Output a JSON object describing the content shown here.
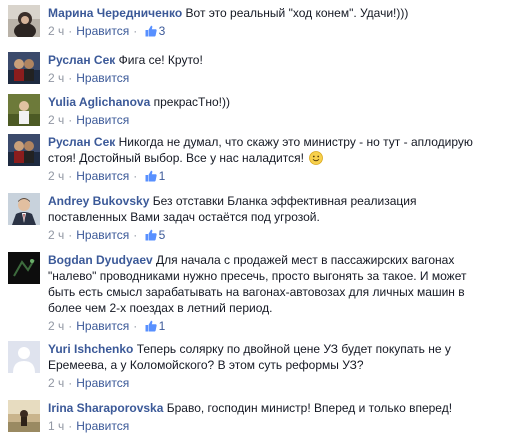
{
  "like_label": "Нравится",
  "comments": [
    {
      "author": "Марина Чередниченко",
      "text": "Вот это реальный \"ход конем\". Удачи!)))",
      "time": "2 ч",
      "likes": "3"
    },
    {
      "author": "Руслан Сек",
      "text": "Фига се! Круто!",
      "time": "2 ч",
      "likes": ""
    },
    {
      "author": "Yulia Aglichanova",
      "text": "прекрасТно!))",
      "time": "2 ч",
      "likes": ""
    },
    {
      "author": "Руслан Сек",
      "text": "Никогда не думал, что скажу это министру - но тут - аплодирую стоя! Достойный выбор. Все у нас наладится!",
      "time": "2 ч",
      "likes": "1"
    },
    {
      "author": "Andrey Bukovsky",
      "text": "Без отставки Бланка эффективная реализация поставленных Вами задач остаётся под угрозой.",
      "time": "2 ч",
      "likes": "5"
    },
    {
      "author": "Bogdan Dyudyaev",
      "text": "Для начала с продажей мест в пассажирских вагонах \"налево\" проводниками нужно пресечь, просто выгонять за такое. И может быть есть смысл зарабатывать на вагонах-автовозах для личных машин в более чем 2-х поездах в летний период.",
      "time": "2 ч",
      "likes": "1"
    },
    {
      "author": "Yuri Ishchenko",
      "text": "Теперь солярку по двойной цене УЗ будет покупать не у Еремеева, а у Коломойского? В этом суть реформы УЗ?",
      "time": "2 ч",
      "likes": ""
    },
    {
      "author": "Irina Sharaporovska",
      "text": "Браво, господин министр! Вперед и только вперед!",
      "time": "1 ч",
      "likes": ""
    }
  ],
  "colors": {
    "link": "#3b5998",
    "meta": "#9197a3",
    "text": "#141823"
  }
}
